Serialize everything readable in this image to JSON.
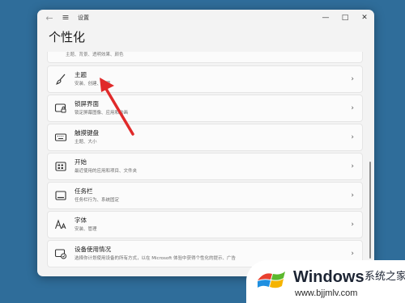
{
  "window": {
    "title": "设置",
    "back_glyph": "←",
    "menu_glyph": "≡",
    "minimize_glyph": "—",
    "maximize_glyph": "□",
    "close_glyph": "✕"
  },
  "page": {
    "title": "个性化",
    "top_strip_text": "主题、背景、透明效果、颜色"
  },
  "items": [
    {
      "title": "主题",
      "subtitle": "安装、创建、管理",
      "icon": "brush-icon",
      "chevron": "›"
    },
    {
      "title": "锁屏界面",
      "subtitle": "锁定屏幕图像、应用和动画",
      "icon": "lock-screen-icon",
      "chevron": "›"
    },
    {
      "title": "触摸键盘",
      "subtitle": "主题、大小",
      "icon": "keyboard-icon",
      "chevron": "›"
    },
    {
      "title": "开始",
      "subtitle": "最近使用的应用和项目、文件夹",
      "icon": "start-icon",
      "chevron": "›"
    },
    {
      "title": "任务栏",
      "subtitle": "任务栏行为、系统固定",
      "icon": "taskbar-icon",
      "chevron": "›"
    },
    {
      "title": "字体",
      "subtitle": "安装、管理",
      "icon": "font-icon",
      "chevron": "›"
    },
    {
      "title": "设备使用情况",
      "subtitle": "选择你计划使用设备的所有方式，以在 Microsoft 体验中获得个性化的提示、广告",
      "icon": "device-usage-icon",
      "chevron": "›"
    }
  ],
  "watermark": {
    "brand": "Windows",
    "brand_cn": "系统之家",
    "url": "www.bjjmlv.com"
  },
  "colors": {
    "desktop": "#2f6d9a",
    "window_bg": "#f3f3f3",
    "card_bg": "#fbfbfb",
    "annotation_arrow": "#e02a2a"
  }
}
